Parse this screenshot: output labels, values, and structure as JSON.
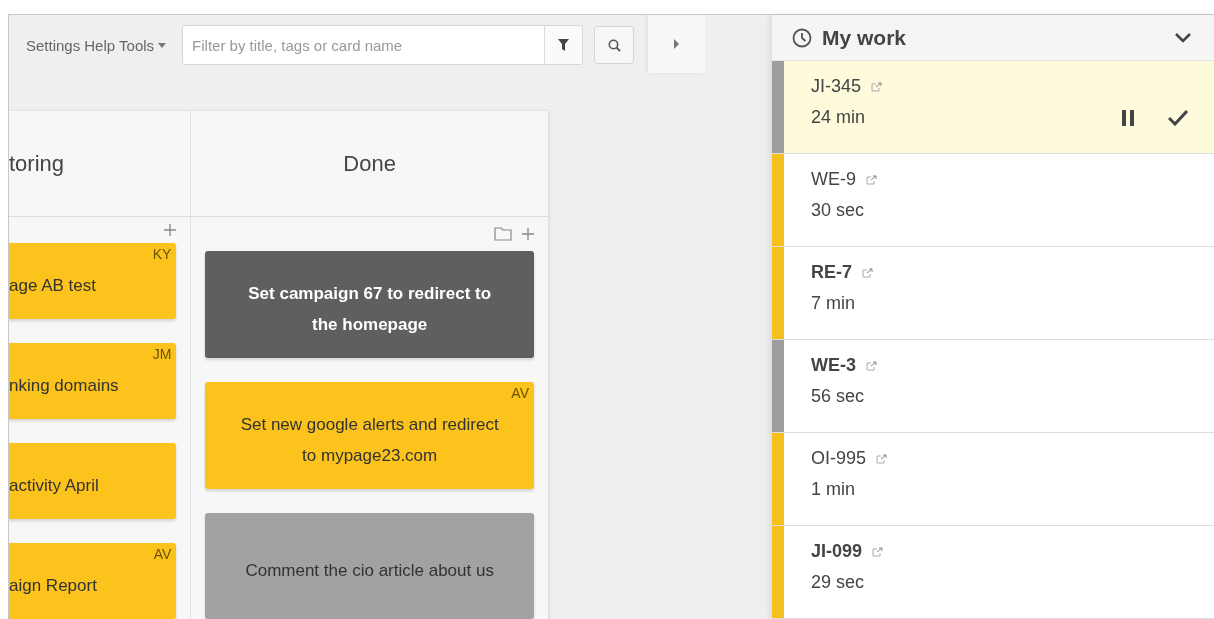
{
  "toolbar": {
    "links": [
      {
        "label": "Settings",
        "kind": "plain"
      },
      {
        "label": "Help",
        "kind": "plain"
      },
      {
        "label": "Tools",
        "kind": "dropdown"
      }
    ],
    "filter": {
      "placeholder": "Filter by title, tags or card name"
    }
  },
  "board": {
    "columns": [
      {
        "title": "toring",
        "actions": [
          {
            "kind": "add"
          }
        ],
        "cropped": true,
        "cards": [
          {
            "text": "age AB test",
            "initials": "KY",
            "color": "#fbc31b"
          },
          {
            "text": "nking domains",
            "initials": "JM",
            "color": "#fbc31b"
          },
          {
            "text": "activity April",
            "color": "#fbc31b"
          },
          {
            "text": "aign Report",
            "initials": "AV",
            "color": "#fbc31b"
          }
        ]
      },
      {
        "title": "Done",
        "actions": [
          {
            "kind": "folder"
          },
          {
            "kind": "add"
          }
        ],
        "cropped": false,
        "cards": [
          {
            "text": "Set campaign 67 to redirect to the homepage",
            "color": "#5f5f5f"
          },
          {
            "text": "Set new google alerts and redirect to mypage23.com",
            "initials": "AV",
            "color": "#fbc31b"
          },
          {
            "text": "Comment the cio article about us",
            "color": "#a2a2a2"
          }
        ]
      }
    ]
  },
  "my_work": {
    "title": "My work",
    "expanded": true,
    "items": [
      {
        "id": "JI-345",
        "time": "24 min",
        "bold": false,
        "selected": true,
        "color": "#9e9e9e"
      },
      {
        "id": "WE-9",
        "time": "30 sec",
        "bold": false,
        "selected": false,
        "color": "#f5c01b"
      },
      {
        "id": "RE-7",
        "time": "7 min",
        "bold": true,
        "selected": false,
        "color": "#f5c01b"
      },
      {
        "id": "WE-3",
        "time": "56 sec",
        "bold": true,
        "selected": false,
        "color": "#9e9e9e"
      },
      {
        "id": "OI-995",
        "time": "1 min",
        "bold": false,
        "selected": false,
        "color": "#f5c01b"
      },
      {
        "id": "JI-099",
        "time": "29 sec",
        "bold": true,
        "selected": false,
        "color": "#f5c01b"
      }
    ]
  }
}
